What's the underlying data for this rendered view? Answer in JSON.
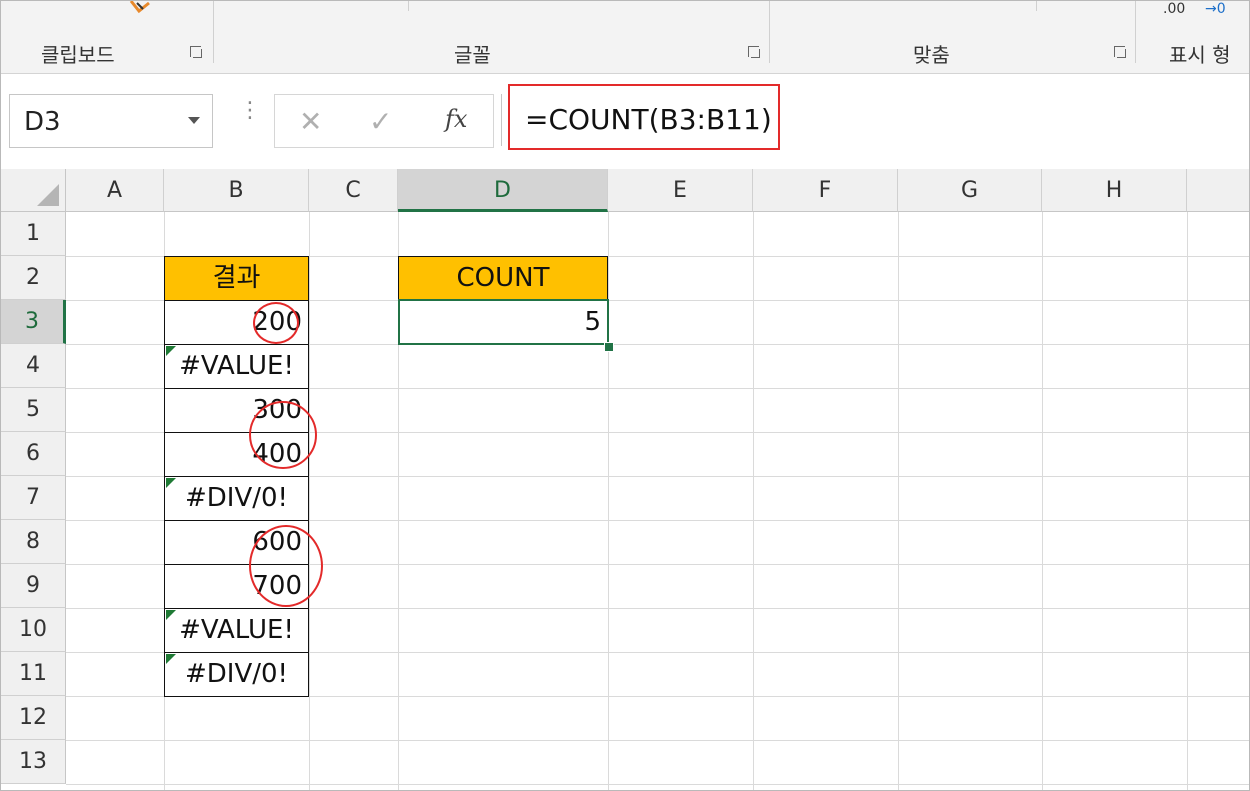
{
  "ribbon": {
    "groups": [
      {
        "label": "클립보드"
      },
      {
        "label": "글꼴"
      },
      {
        "label": "맞춤"
      },
      {
        "label": "표시 형"
      }
    ],
    "decimal_buttons": {
      "decrease": ".00",
      "increase": "→0"
    }
  },
  "formula_bar": {
    "name_box": "D3",
    "cancel_symbol": "✕",
    "enter_symbol": "✓",
    "fx_label": "fx",
    "formula": "=COUNT(B3:B11)"
  },
  "columns": [
    "A",
    "B",
    "C",
    "D",
    "E",
    "F",
    "G",
    "H"
  ],
  "selected_column": "D",
  "rows": [
    "1",
    "2",
    "3",
    "4",
    "5",
    "6",
    "7",
    "8",
    "9",
    "10",
    "11",
    "12",
    "13"
  ],
  "selected_row": "3",
  "sheet": {
    "b_header": "결과",
    "b_values": [
      "200",
      "#VALUE!",
      "300",
      "400",
      "#DIV/0!",
      "600",
      "700",
      "#VALUE!",
      "#DIV/0!"
    ],
    "d_header": "COUNT",
    "d_value": "5"
  },
  "colors": {
    "header_fill": "#ffc000",
    "selection": "#217346",
    "annotation": "#e32a2a",
    "error_indicator": "#1f7a35"
  }
}
